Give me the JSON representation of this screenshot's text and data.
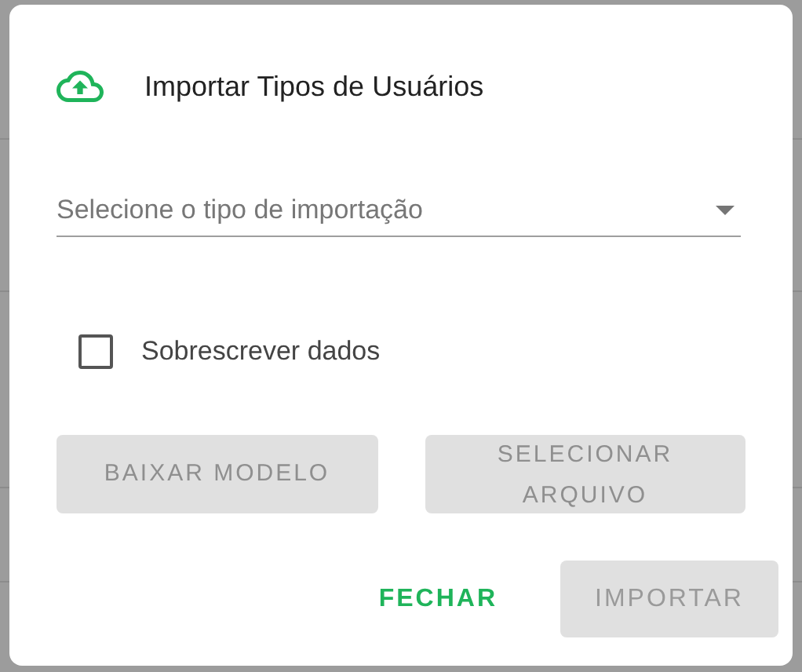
{
  "dialog": {
    "title": "Importar Tipos de Usuários",
    "select": {
      "placeholder": "Selecione o tipo de importação"
    },
    "checkbox": {
      "label": "Sobrescrever dados",
      "checked": false
    },
    "actions": [
      {
        "label": "BAIXAR MODELO",
        "disabled": true
      },
      {
        "label": "SELECIONAR ARQUIVO",
        "disabled": true
      }
    ],
    "footer": [
      {
        "label": "FECHAR",
        "kind": "text",
        "disabled": false
      },
      {
        "label": "IMPORTAR",
        "kind": "filled",
        "disabled": true
      }
    ]
  }
}
